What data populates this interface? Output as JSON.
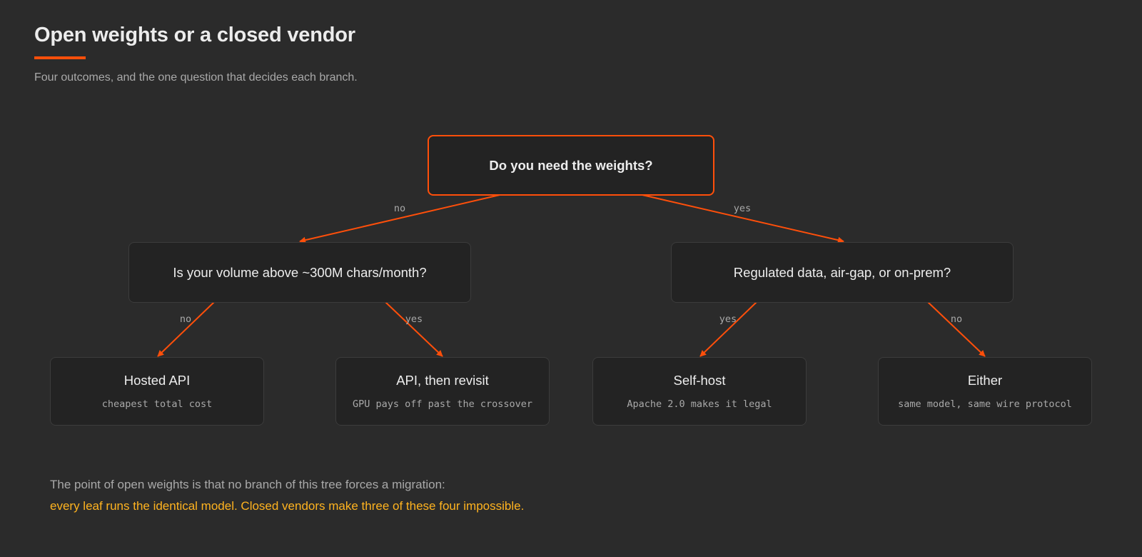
{
  "header": {
    "title": "Open weights or a closed vendor",
    "subtitle": "Four outcomes, and the one question that decides each branch."
  },
  "colors": {
    "background": "#2b2b2b",
    "accent": "#ff4f0a",
    "highlight_text": "#ffb31f",
    "muted_text": "#a9a9a9",
    "node_fill": "#232323",
    "node_border": "#3c3c3c"
  },
  "tree": {
    "root": {
      "label": "Do you need the weights?"
    },
    "left_question": {
      "label": "Is your volume above ~300M chars/month?"
    },
    "right_question": {
      "label": "Regulated data, air-gap, or on-prem?"
    },
    "edges": {
      "root_left": "no",
      "root_right": "yes",
      "left_to_hosted": "no",
      "left_to_revisit": "yes",
      "right_to_selfhost": "yes",
      "right_to_either": "no"
    },
    "leaves": [
      {
        "title": "Hosted API",
        "note": "cheapest total cost"
      },
      {
        "title": "API, then revisit",
        "note": "GPU pays off past the crossover"
      },
      {
        "title": "Self-host",
        "note": "Apache 2.0 makes it legal"
      },
      {
        "title": "Either",
        "note": "same model, same wire protocol"
      }
    ]
  },
  "footer": {
    "line1": "The point of open weights is that no branch of this tree forces a migration:",
    "line2": "every leaf runs the identical model. Closed vendors make three of these four impossible."
  }
}
